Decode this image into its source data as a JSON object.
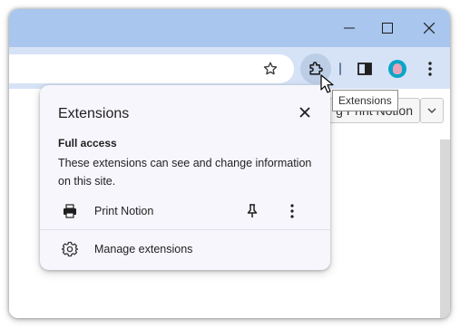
{
  "window": {
    "controls": [
      "minimize",
      "maximize",
      "close"
    ]
  },
  "toolbar": {
    "bookmark_icon": "star-icon",
    "extensions_icon": "puzzle-piece-icon",
    "side_panel_icon": "side-panel-icon",
    "profile_icon": "avatar",
    "menu_icon": "kebab-menu-icon",
    "colors": {
      "titlebar": "#a8c6ee",
      "toolbar": "#d6e3f7",
      "avatar": "#0aa6c8"
    }
  },
  "tooltip": {
    "text": "Extensions"
  },
  "page": {
    "button_label": "g Print Notion"
  },
  "extensions_popup": {
    "title": "Extensions",
    "full_access": {
      "heading": "Full access",
      "description": "These extensions can see and change information on this site."
    },
    "extensions": [
      {
        "name": "Print Notion",
        "icon": "printer-icon"
      }
    ],
    "manage_label": "Manage extensions"
  }
}
